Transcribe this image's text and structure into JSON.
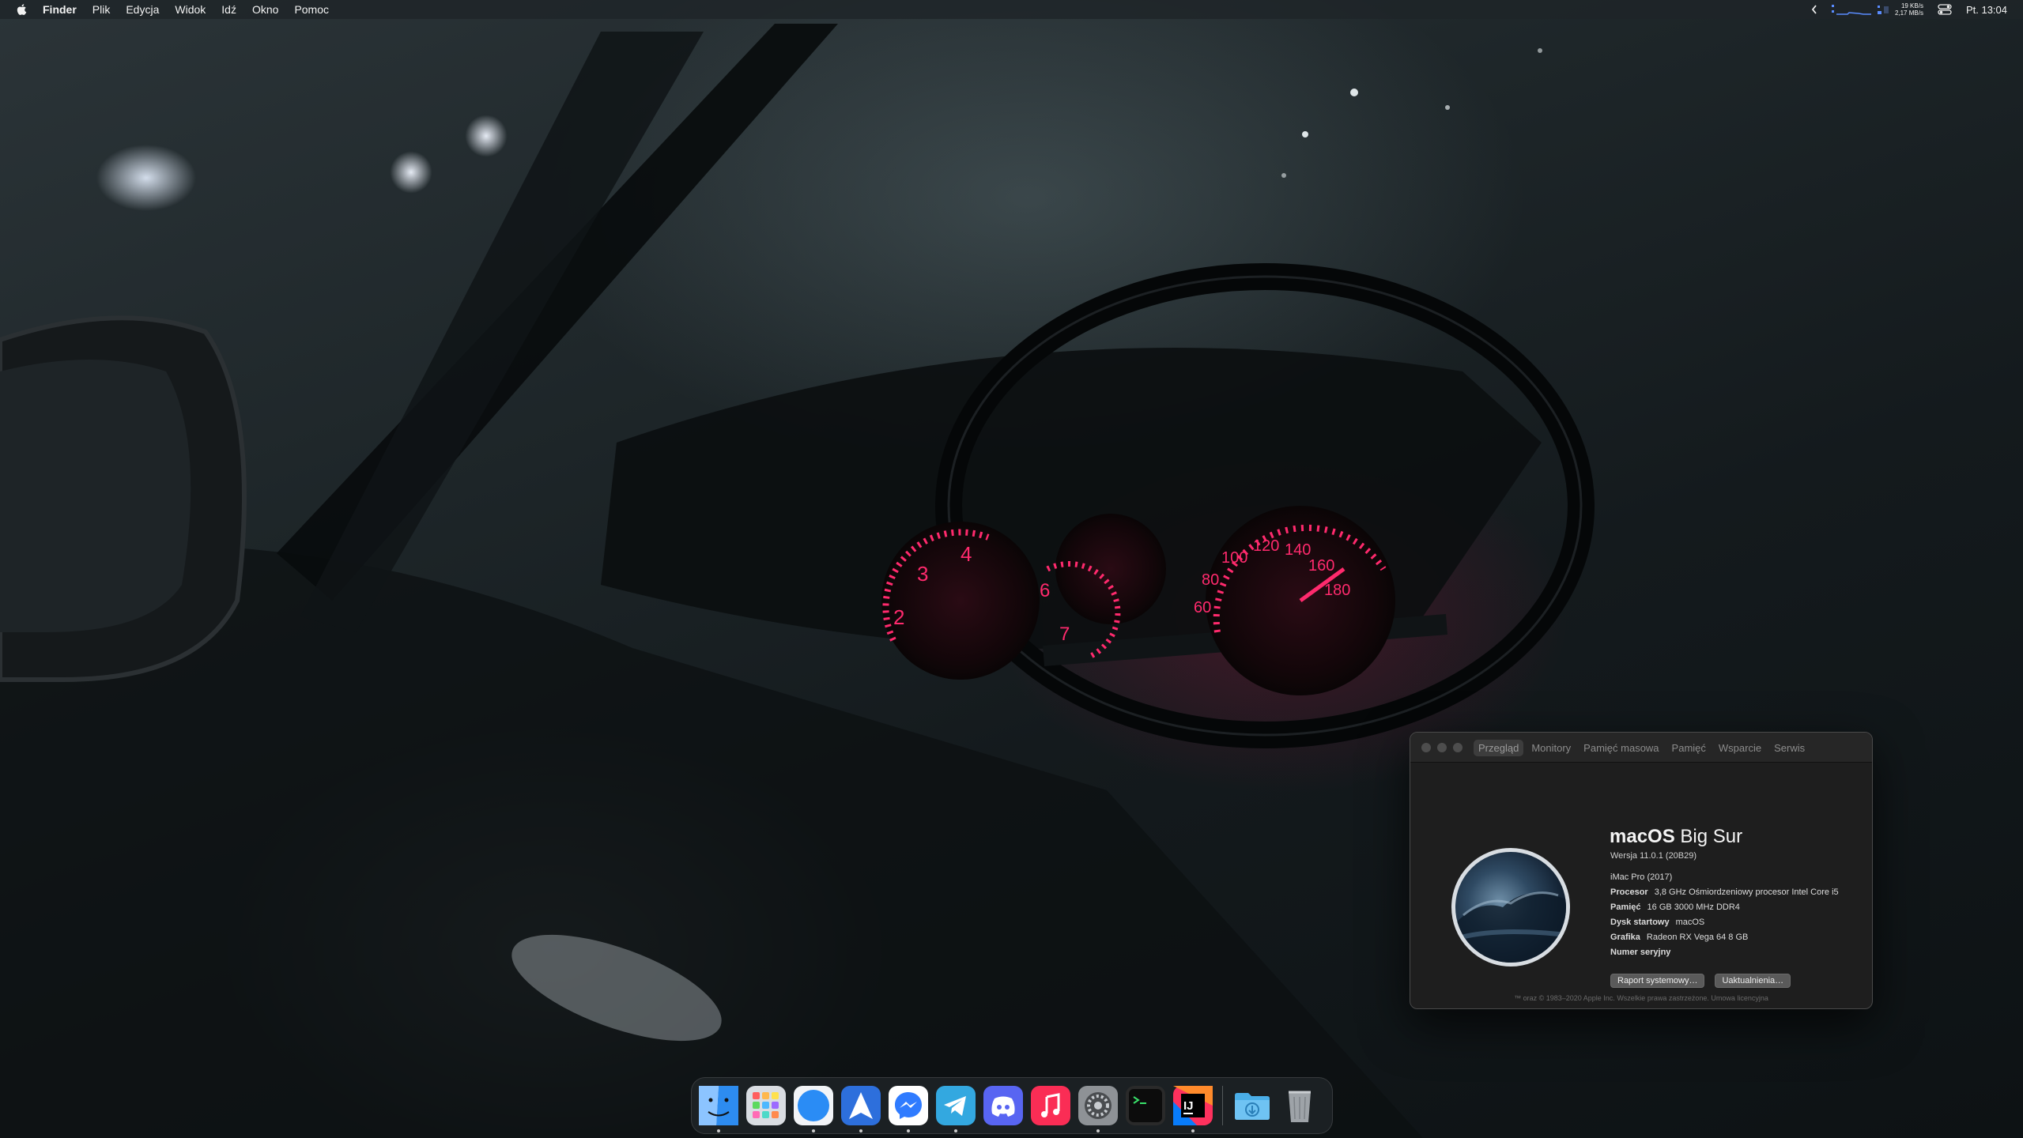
{
  "menubar": {
    "app_name": "Finder",
    "menus": [
      "Plik",
      "Edycja",
      "Widok",
      "Idź",
      "Okno",
      "Pomoc"
    ],
    "net_upload": "19 KB/s",
    "net_download": "2,17 MB/s",
    "clock": "Pt. 13:04"
  },
  "about": {
    "tabs": [
      "Przegląd",
      "Monitory",
      "Pamięć masowa",
      "Pamięć",
      "Wsparcie",
      "Serwis"
    ],
    "active_tab": "Przegląd",
    "os_name_bold": "macOS",
    "os_name_light": " Big Sur",
    "version": "Wersja 11.0.1 (20B29)",
    "model": "iMac Pro (2017)",
    "specs": [
      {
        "key": "Procesor",
        "value": "3,8 GHz Ośmiordzeniowy procesor Intel Core i5"
      },
      {
        "key": "Pamięć",
        "value": "16 GB 3000 MHz DDR4"
      },
      {
        "key": "Dysk startowy",
        "value": "macOS"
      },
      {
        "key": "Grafika",
        "value": "Radeon RX Vega 64 8  GB"
      },
      {
        "key": "Numer seryjny",
        "value": ""
      }
    ],
    "report_button": "Raport systemowy…",
    "update_button": "Uaktualnienia…",
    "footer": "™ oraz © 1983–2020 Apple Inc. Wszelkie prawa zastrzeżone. Umowa licencyjna"
  },
  "dock": {
    "apps": [
      {
        "name": "finder-icon",
        "running": true
      },
      {
        "name": "launchpad-icon",
        "running": false
      },
      {
        "name": "safari-icon",
        "running": true
      },
      {
        "name": "spark-mail-icon",
        "running": true
      },
      {
        "name": "messenger-icon",
        "running": true
      },
      {
        "name": "telegram-icon",
        "running": true
      },
      {
        "name": "discord-icon",
        "running": false
      },
      {
        "name": "music-icon",
        "running": false
      },
      {
        "name": "system-preferences-icon",
        "running": true
      },
      {
        "name": "terminal-icon",
        "running": false
      },
      {
        "name": "intellij-icon",
        "running": true
      },
      {
        "name": "downloads-folder-icon",
        "running": false
      },
      {
        "name": "trash-icon",
        "running": false
      }
    ]
  },
  "colors": {
    "gauge_pink": "#ff2a6d",
    "window_bg": "#1e1e1e",
    "menubar_bg": "#1e2428"
  }
}
